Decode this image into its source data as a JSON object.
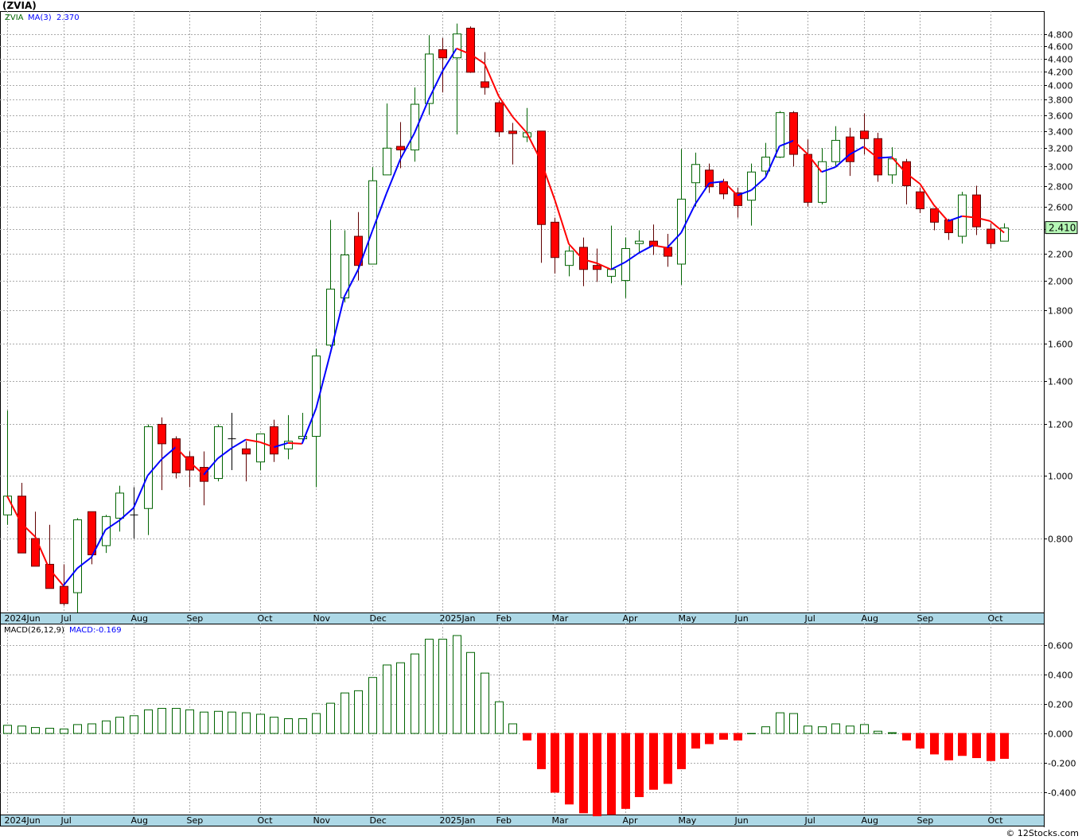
{
  "title": "(ZVIA)",
  "credit": "© 12Stocks.com",
  "colors": {
    "up": "#006400",
    "down": "#ff0000",
    "down_edge": "#600000",
    "ma_up": "#0000ff",
    "ma_down": "#ff0000",
    "axis_strip": "#add8e6",
    "last_tag": "#b6f7b6"
  },
  "chart_data": [
    {
      "type": "candlestick",
      "legend": {
        "symbol": "ZVIA",
        "indicator": "MA(3)",
        "indicator_value": "2.370"
      },
      "last_price": "2.410",
      "y_scale": "log",
      "ylim": [
        0.62,
        5.0
      ],
      "grid": true,
      "y_ticks": [
        "4.800",
        "4.600",
        "4.400",
        "4.200",
        "4.000",
        "3.800",
        "3.600",
        "3.400",
        "3.200",
        "3.000",
        "2.800",
        "2.600",
        "2.400",
        "2.200",
        "2.000",
        "1.800",
        "1.600",
        "1.400",
        "1.200",
        "1.000",
        "0.800"
      ],
      "x_ticks": [
        {
          "label": "2024Jun",
          "week": 0
        },
        {
          "label": "Jul",
          "week": 4
        },
        {
          "label": "Aug",
          "week": 9
        },
        {
          "label": "Sep",
          "week": 13
        },
        {
          "label": "Oct",
          "week": 18
        },
        {
          "label": "Nov",
          "week": 22
        },
        {
          "label": "Dec",
          "week": 26
        },
        {
          "label": "2025Jan",
          "week": 31
        },
        {
          "label": "Feb",
          "week": 35
        },
        {
          "label": "Mar",
          "week": 39
        },
        {
          "label": "Apr",
          "week": 44
        },
        {
          "label": "May",
          "week": 48
        },
        {
          "label": "Jun",
          "week": 52
        },
        {
          "label": "Jul",
          "week": 57
        },
        {
          "label": "Aug",
          "week": 61
        },
        {
          "label": "Sep",
          "week": 65
        },
        {
          "label": "Oct",
          "week": 70
        }
      ],
      "ohlc_fields": [
        "open",
        "high",
        "low",
        "close"
      ],
      "ohlc": [
        [
          0.87,
          1.26,
          0.84,
          0.93
        ],
        [
          0.93,
          0.975,
          0.76,
          0.76
        ],
        [
          0.8,
          0.88,
          0.725,
          0.725
        ],
        [
          0.73,
          0.84,
          0.67,
          0.67
        ],
        [
          0.675,
          0.73,
          0.63,
          0.635
        ],
        [
          0.66,
          0.86,
          0.615,
          0.855
        ],
        [
          0.88,
          0.88,
          0.73,
          0.755
        ],
        [
          0.78,
          0.87,
          0.76,
          0.865
        ],
        [
          0.86,
          0.965,
          0.82,
          0.94
        ],
        [
          0.87,
          0.96,
          0.8,
          0.87
        ],
        [
          0.89,
          1.2,
          0.81,
          1.19
        ],
        [
          1.2,
          1.23,
          0.95,
          1.12
        ],
        [
          1.14,
          1.15,
          0.99,
          1.01
        ],
        [
          1.07,
          1.09,
          0.96,
          1.02
        ],
        [
          1.03,
          1.09,
          0.9,
          0.98
        ],
        [
          0.99,
          1.2,
          0.98,
          1.19
        ],
        [
          1.14,
          1.25,
          1.02,
          1.14
        ],
        [
          1.1,
          1.13,
          0.98,
          1.08
        ],
        [
          1.05,
          1.16,
          1.02,
          1.16
        ],
        [
          1.19,
          1.22,
          1.05,
          1.08
        ],
        [
          1.1,
          1.24,
          1.06,
          1.13
        ],
        [
          1.14,
          1.25,
          1.13,
          1.15
        ],
        [
          1.15,
          1.57,
          0.96,
          1.53
        ],
        [
          1.59,
          2.48,
          1.58,
          1.94
        ],
        [
          1.88,
          2.39,
          1.85,
          2.19
        ],
        [
          2.34,
          2.55,
          2.0,
          2.11
        ],
        [
          2.12,
          2.99,
          2.12,
          2.85
        ],
        [
          2.91,
          3.75,
          2.91,
          3.2
        ],
        [
          3.22,
          3.51,
          2.98,
          3.18
        ],
        [
          3.18,
          3.97,
          3.05,
          3.74
        ],
        [
          3.75,
          4.78,
          3.6,
          4.47
        ],
        [
          4.54,
          4.73,
          3.9,
          4.41
        ],
        [
          4.41,
          4.98,
          3.36,
          4.8
        ],
        [
          4.9,
          4.93,
          4.18,
          4.19
        ],
        [
          4.05,
          4.5,
          3.87,
          3.97
        ],
        [
          3.76,
          3.79,
          3.33,
          3.39
        ],
        [
          3.4,
          3.5,
          3.02,
          3.37
        ],
        [
          3.33,
          3.69,
          3.27,
          3.38
        ],
        [
          3.4,
          3.4,
          2.13,
          2.44
        ],
        [
          2.46,
          2.5,
          2.05,
          2.17
        ],
        [
          2.11,
          2.26,
          2.03,
          2.22
        ],
        [
          2.25,
          2.33,
          1.96,
          2.08
        ],
        [
          2.11,
          2.24,
          1.99,
          2.08
        ],
        [
          2.03,
          2.43,
          1.98,
          2.08
        ],
        [
          2.0,
          2.33,
          1.88,
          2.24
        ],
        [
          2.28,
          2.39,
          2.2,
          2.3
        ],
        [
          2.3,
          2.44,
          2.19,
          2.26
        ],
        [
          2.25,
          2.36,
          2.1,
          2.18
        ],
        [
          2.12,
          3.19,
          1.97,
          2.67
        ],
        [
          2.83,
          3.15,
          2.6,
          3.02
        ],
        [
          2.96,
          3.03,
          2.73,
          2.79
        ],
        [
          2.84,
          2.87,
          2.67,
          2.72
        ],
        [
          2.73,
          2.78,
          2.5,
          2.61
        ],
        [
          2.66,
          3.03,
          2.43,
          2.94
        ],
        [
          2.95,
          3.26,
          2.9,
          3.1
        ],
        [
          3.1,
          3.65,
          3.09,
          3.63
        ],
        [
          3.63,
          3.65,
          3.0,
          3.13
        ],
        [
          3.13,
          3.3,
          2.6,
          2.64
        ],
        [
          2.64,
          3.2,
          2.62,
          3.05
        ],
        [
          3.05,
          3.46,
          3.0,
          3.29
        ],
        [
          3.33,
          3.44,
          2.9,
          3.05
        ],
        [
          3.4,
          3.62,
          3.13,
          3.31
        ],
        [
          3.31,
          3.38,
          2.84,
          2.91
        ],
        [
          2.91,
          3.21,
          2.82,
          3.08
        ],
        [
          3.05,
          3.08,
          2.62,
          2.8
        ],
        [
          2.74,
          2.78,
          2.54,
          2.58
        ],
        [
          2.58,
          2.58,
          2.39,
          2.46
        ],
        [
          2.48,
          2.49,
          2.31,
          2.37
        ],
        [
          2.34,
          2.74,
          2.28,
          2.71
        ],
        [
          2.71,
          2.8,
          2.35,
          2.42
        ],
        [
          2.4,
          2.45,
          2.24,
          2.28
        ],
        [
          2.3,
          2.45,
          2.3,
          2.41
        ]
      ]
    },
    {
      "type": "bar",
      "legend": {
        "indicator": "MACD(26,12,9)",
        "value_label": "MACD:-0.169"
      },
      "ylim": [
        -0.55,
        0.68
      ],
      "grid": true,
      "y_ticks": [
        "0.600",
        "0.400",
        "0.200",
        "0.000",
        "-0.200",
        "-0.400"
      ],
      "values": [
        0.055,
        0.05,
        0.04,
        0.035,
        0.03,
        0.06,
        0.065,
        0.085,
        0.11,
        0.12,
        0.16,
        0.17,
        0.17,
        0.16,
        0.145,
        0.15,
        0.145,
        0.14,
        0.13,
        0.11,
        0.1,
        0.1,
        0.135,
        0.205,
        0.275,
        0.29,
        0.38,
        0.465,
        0.48,
        0.54,
        0.64,
        0.64,
        0.665,
        0.55,
        0.41,
        0.215,
        0.065,
        -0.045,
        -0.24,
        -0.4,
        -0.48,
        -0.54,
        -0.56,
        -0.55,
        -0.51,
        -0.43,
        -0.38,
        -0.34,
        -0.24,
        -0.1,
        -0.07,
        -0.04,
        -0.045,
        0.0,
        0.045,
        0.14,
        0.135,
        0.05,
        0.045,
        0.065,
        0.05,
        0.06,
        0.015,
        0.005,
        -0.045,
        -0.1,
        -0.14,
        -0.18,
        -0.15,
        -0.165,
        -0.185,
        -0.17
      ]
    }
  ]
}
